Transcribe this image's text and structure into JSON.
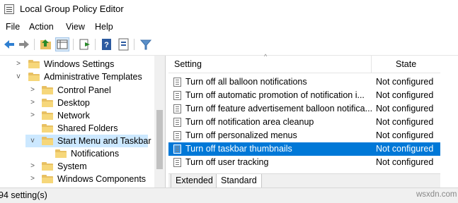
{
  "window": {
    "title": "Local Group Policy Editor"
  },
  "menu": [
    "File",
    "Action",
    "View",
    "Help"
  ],
  "toolbar": {
    "buttons": [
      "back-arrow-icon",
      "forward-arrow-icon",
      "up-folder-icon",
      "show-hide-tree-icon",
      "export-list-icon",
      "help-icon",
      "properties-icon",
      "filter-icon"
    ]
  },
  "tree": {
    "items": [
      {
        "label": "Windows Settings",
        "chevron": ">"
      },
      {
        "label": "Administrative Templates",
        "chevron": "v"
      },
      {
        "label": "Control Panel",
        "chevron": ">"
      },
      {
        "label": "Desktop",
        "chevron": ">"
      },
      {
        "label": "Network",
        "chevron": ">"
      },
      {
        "label": "Shared Folders",
        "chevron": ""
      },
      {
        "label": "Start Menu and Taskbar",
        "chevron": "v"
      },
      {
        "label": "Notifications",
        "chevron": ""
      },
      {
        "label": "System",
        "chevron": ">"
      },
      {
        "label": "Windows Components",
        "chevron": ">"
      }
    ]
  },
  "list": {
    "headers": {
      "setting": "Setting",
      "state": "State"
    },
    "rows": [
      {
        "name": "Turn off all balloon notifications",
        "state": "Not configured"
      },
      {
        "name": "Turn off automatic promotion of notification i...",
        "state": "Not configured"
      },
      {
        "name": "Turn off feature advertisement balloon notifica...",
        "state": "Not configured"
      },
      {
        "name": "Turn off notification area cleanup",
        "state": "Not configured"
      },
      {
        "name": "Turn off personalized menus",
        "state": "Not configured"
      },
      {
        "name": "Turn off taskbar thumbnails",
        "state": "Not configured"
      },
      {
        "name": "Turn off user tracking",
        "state": "Not configured"
      }
    ]
  },
  "tabs": {
    "extended": "Extended",
    "standard": "Standard"
  },
  "status": {
    "text": "94 setting(s)"
  },
  "watermark": "wsxdn.com",
  "colors": {
    "selection": "#0078d7",
    "tree_selection": "#cce8ff",
    "folder": "#f6d77a"
  }
}
